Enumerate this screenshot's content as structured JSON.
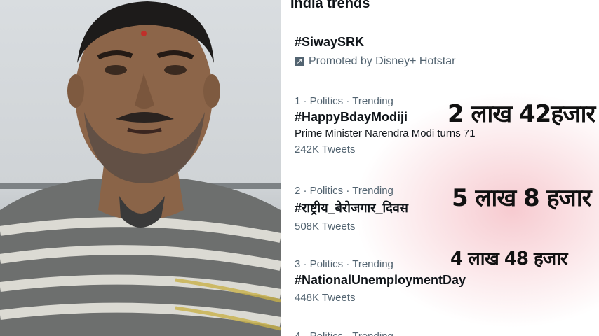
{
  "panel": {
    "title": "India trends"
  },
  "promoted": {
    "tag": "#SiwaySRK",
    "label": "Promoted by Disney+ Hotstar",
    "icon": "promoted-arrow-icon"
  },
  "trends": [
    {
      "meta": "1 · Politics · Trending",
      "tag": "#HappyBdayModiji",
      "desc": "Prime Minister Narendra Modi turns 71",
      "count": "242K Tweets"
    },
    {
      "meta": "2 · Politics · Trending",
      "tag": "#राष्ट्रीय_बेरोजगार_दिवस",
      "desc": "",
      "count": "508K Tweets"
    },
    {
      "meta": "3 · Politics · Trending",
      "tag": "#NationalUnemploymentDay",
      "desc": "",
      "count": "448K Tweets"
    },
    {
      "meta": "4 · Politics · Trending",
      "tag": "",
      "desc": "",
      "count": ""
    }
  ],
  "overlays": [
    "2 लाख 42हजार",
    "5 लाख 8 हजार",
    "4 लाख 48 हजार"
  ]
}
